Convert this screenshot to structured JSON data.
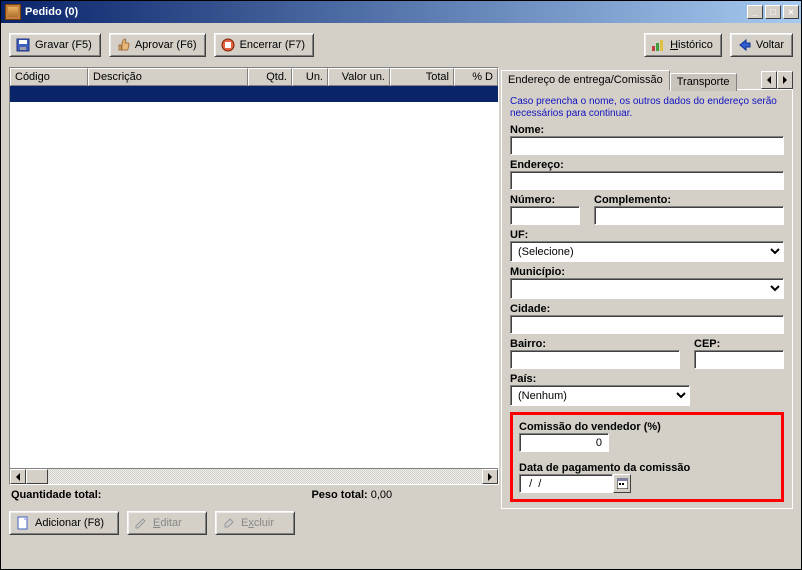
{
  "window": {
    "title": "Pedido (0)"
  },
  "toolbar": {
    "gravar": "Gravar (F5)",
    "aprovar": "Aprovar (F6)",
    "encerrar": "Encerrar (F7)",
    "historico": "Histórico",
    "voltar": "Voltar"
  },
  "grid": {
    "headers": {
      "codigo": "Código",
      "descricao": "Descrição",
      "qtd": "Qtd.",
      "un": "Un.",
      "valor_un": "Valor un.",
      "total": "Total",
      "pct_d": "% D"
    }
  },
  "totals": {
    "qtd_label": "Quantidade total:",
    "peso_label": "Peso total:",
    "peso_value": "0,00"
  },
  "actions": {
    "adicionar": "Adicionar (F8)",
    "editar": "Editar",
    "excluir": "Excluir"
  },
  "tabs": {
    "entrega": "Endereço de entrega/Comissão",
    "transporte": "Transporte"
  },
  "form": {
    "hint": "Caso preencha o nome, os outros dados do endereço serão necessários para continuar.",
    "nome": "Nome:",
    "endereco": "Endereço:",
    "numero": "Número:",
    "complemento": "Complemento:",
    "uf": "UF:",
    "uf_value": "(Selecione)",
    "municipio": "Município:",
    "cidade": "Cidade:",
    "bairro": "Bairro:",
    "cep": "CEP:",
    "pais": "País:",
    "pais_value": "(Nenhum)",
    "comissao": "Comissão do vendedor (%)",
    "comissao_value": "0",
    "data_pag": "Data de pagamento da comissão",
    "data_value": "  /  /"
  }
}
